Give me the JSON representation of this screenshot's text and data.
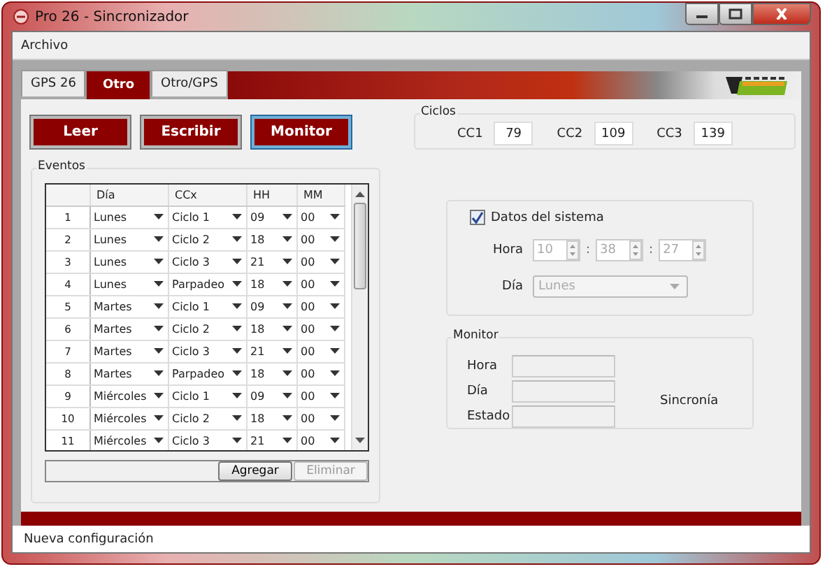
{
  "window": {
    "title": "Pro 26 - Sincronizador"
  },
  "menu": [
    "Archivo"
  ],
  "tabs": [
    {
      "label": "GPS 26",
      "selected": false
    },
    {
      "label": "Otro",
      "selected": true
    },
    {
      "label": "Otro/GPS",
      "selected": false
    }
  ],
  "actions": [
    {
      "label": "Leer",
      "focused": false
    },
    {
      "label": "Escribir",
      "focused": false
    },
    {
      "label": "Monitor",
      "focused": true
    }
  ],
  "ciclos": {
    "title": "Ciclos",
    "fields": [
      {
        "label": "CC1",
        "value": "79"
      },
      {
        "label": "CC2",
        "value": "109"
      },
      {
        "label": "CC3",
        "value": "139"
      }
    ]
  },
  "eventos": {
    "title": "Eventos",
    "columns": [
      "Día",
      "CCx",
      "HH",
      "MM"
    ],
    "rows": [
      {
        "number": "1",
        "cells": [
          "Lunes",
          "Ciclo 1",
          "09",
          "00"
        ]
      },
      {
        "number": "2",
        "cells": [
          "Lunes",
          "Ciclo 2",
          "18",
          "00"
        ]
      },
      {
        "number": "3",
        "cells": [
          "Lunes",
          "Ciclo 3",
          "21",
          "00"
        ]
      },
      {
        "number": "4",
        "cells": [
          "Lunes",
          "Parpadeo",
          "18",
          "00"
        ]
      },
      {
        "number": "5",
        "cells": [
          "Martes",
          "Ciclo 1",
          "09",
          "00"
        ]
      },
      {
        "number": "6",
        "cells": [
          "Martes",
          "Ciclo 2",
          "18",
          "00"
        ]
      },
      {
        "number": "7",
        "cells": [
          "Martes",
          "Ciclo 3",
          "21",
          "00"
        ]
      },
      {
        "number": "8",
        "cells": [
          "Martes",
          "Parpadeo",
          "18",
          "00"
        ]
      },
      {
        "number": "9",
        "cells": [
          "Miércoles",
          "Ciclo 1",
          "09",
          "00"
        ]
      },
      {
        "number": "10",
        "cells": [
          "Miércoles",
          "Ciclo 2",
          "18",
          "00"
        ]
      },
      {
        "number": "11",
        "cells": [
          "Miércoles",
          "Ciclo 3",
          "21",
          "00"
        ]
      }
    ],
    "buttons": [
      {
        "label": "Agregar",
        "disabled": false
      },
      {
        "label": "Eliminar",
        "disabled": true
      }
    ]
  },
  "sistema": {
    "checkbox": {
      "label": "Datos del sistema",
      "checked": true
    },
    "hora": {
      "label": "Hora",
      "values": [
        "10",
        "38",
        "27"
      ],
      "separator": ":",
      "disabled": true
    },
    "dia": {
      "label": "Día",
      "value": "Lunes",
      "disabled": true
    }
  },
  "monitor": {
    "title": "Monitor",
    "fields": [
      "Hora",
      "Día",
      "Estado"
    ],
    "status": "Sincronía"
  },
  "status_bar": "Nueva configuración"
}
